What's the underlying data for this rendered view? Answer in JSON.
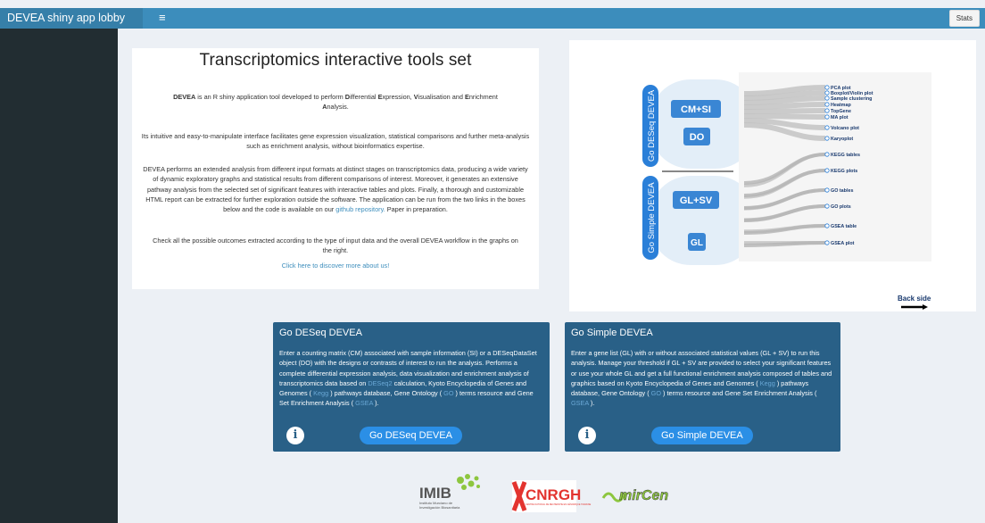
{
  "header": {
    "brand": "DEVEA shiny app lobby",
    "menu_icon": "hamburger-icon",
    "stats_label": "Stats"
  },
  "intro": {
    "title": "Transcriptomics interactive tools set",
    "p1_prefix": "DEVEA",
    "p1_text": " is an R shiny application tool developed to perform ",
    "p1_d": "D",
    "p1_ifferential": "ifferential ",
    "p1_e": "E",
    "p1_xpression": "xpression, ",
    "p1_v": "V",
    "p1_isualisation": "isualisation and ",
    "p1_e2": "E",
    "p1_nrichment": "nrichment",
    "p1_a": "A",
    "p1_nalysis": "nalysis.",
    "p2": "Its intuitive and easy-to-manipulate interface facilitates gene expression visualization, statistical comparisons and further meta-analysis such as enrichment analysis, without bioinformatics expertise.",
    "p3": "DEVEA performs an extended analysis from different input formats at distinct stages on transcriptomics data, producing a wide variety of dynamic exploratory graphs and statistical results from different comparisons of interest. Moreover, it generates an extensive pathway analysis from the selected set of significant features with interactive tables and plots. Finally, a thorough and customizable HTML report can be extracted for further exploration outside the software. The application can be run from the two links in the boxes below and the code is available on our ",
    "p3_link": "github repository.",
    "p3_suffix": " Paper in preparation.",
    "p4": "Check all the possible outcomes extracted according to the type of input data and the overall DEVEA workflow in the graphs on the right.",
    "p5_link": "Click here to discover more about us!"
  },
  "workflow": {
    "left_labels": [
      "Go DESeq DEVEA",
      "Go Simple DEVEA"
    ],
    "inputs": [
      "CM+SI",
      "DO",
      "GL+SV",
      "GL"
    ],
    "outputs": [
      "PCA plot",
      "Boxplot/Violin plot",
      "Sample clustering",
      "Heatmap",
      "TopGene",
      "MA plot",
      "Volcano plot",
      "Karyoplot",
      "KEGG tables",
      "KEGG plots",
      "GO tables",
      "GO plots",
      "GSEA table",
      "GSEA plot"
    ],
    "back_side": "Back side",
    "colors": {
      "pill": "#2a7fd8",
      "input_box": "#3a86d4",
      "bg": "#e3eef8",
      "flow": "#c3c3c3"
    }
  },
  "box_deseq": {
    "title": "Go DESeq DEVEA",
    "text_a": "Enter a counting matrix (CM) associated with sample information (SI) or a DESeqDataSet object (DO) with the designs or contrasts of interest to run the analysis. Performs a complete differential expression analysis, data visualization and enrichment analysis of transcriptomics data based on ",
    "link_deseq2": "DESeq2",
    "text_b": " calculation, Kyoto Encyclopedia of Genes and Genomes (",
    "link_kegg": " Kegg ",
    "text_c": ") pathways database, Gene Ontology (",
    "link_go": " GO ",
    "text_d": ") terms resource and Gene Set Enrichment Analysis (",
    "link_gsea": " GSEA ",
    "text_e": ").",
    "button": "Go DESeq DEVEA",
    "info_icon": "info-icon"
  },
  "box_simple": {
    "title": "Go Simple DEVEA",
    "text_a": "Enter a gene list (GL) with or without associated statistical values (GL + SV) to run this analysis. Manage your threshold if GL + SV are provided to select your significant features or use your whole GL and get a full functional enrichment analysis composed of tables and graphics based on Kyoto Encyclopedia of Genes and Genomes (",
    "link_kegg": " Kegg ",
    "text_b": ") pathways database, Gene Ontology (",
    "link_go": " GO ",
    "text_c": ") terms resource and Gene Set Enrichment Analysis (",
    "link_gsea": " GSEA ",
    "text_d": ").",
    "button": "Go Simple DEVEA",
    "info_icon": "info-icon"
  },
  "logos": {
    "imib": "IMIB",
    "imib_sub1": "Instituto Murciano de",
    "imib_sub2": "Investigación Biosanitaria",
    "cnrgh": "CNRGH",
    "cnrgh_sub": "CENTRE NATIONAL DE RECHERCHE EN GÉNOMIQUE HUMAINE",
    "mircen": "mirCen"
  }
}
